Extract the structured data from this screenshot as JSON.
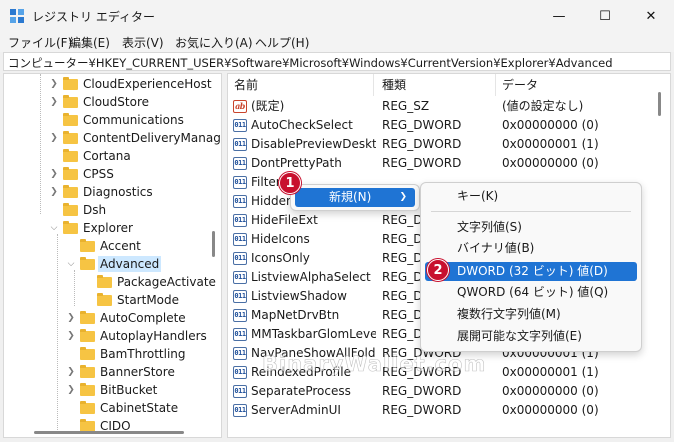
{
  "window": {
    "title": "レジストリ エディター",
    "minimize_glyph": "—",
    "maximize_glyph": "☐",
    "close_glyph": "✕"
  },
  "menubar": [
    {
      "label": "ファイル(F)"
    },
    {
      "label": "編集(E)"
    },
    {
      "label": "表示(V)"
    },
    {
      "label": "お気に入り(A)"
    },
    {
      "label": "ヘルプ(H)"
    }
  ],
  "address": "コンピューター¥HKEY_CURRENT_USER¥Software¥Microsoft¥Windows¥CurrentVersion¥Explorer¥Advanced",
  "tree": {
    "items": [
      {
        "label": "CloudExperienceHost"
      },
      {
        "label": "CloudStore"
      },
      {
        "label": "Communications"
      },
      {
        "label": "ContentDeliveryManag"
      },
      {
        "label": "Cortana"
      },
      {
        "label": "CPSS"
      },
      {
        "label": "Diagnostics"
      },
      {
        "label": "Dsh"
      },
      {
        "label": "Explorer"
      },
      {
        "label": "Accent"
      },
      {
        "label": "Advanced"
      },
      {
        "label": "PackageActivate"
      },
      {
        "label": "StartMode"
      },
      {
        "label": "AutoComplete"
      },
      {
        "label": "AutoplayHandlers"
      },
      {
        "label": "BamThrottling"
      },
      {
        "label": "BannerStore"
      },
      {
        "label": "BitBucket"
      },
      {
        "label": "CabinetState"
      },
      {
        "label": "CIDO"
      }
    ]
  },
  "list": {
    "columns": [
      "名前",
      "種類",
      "データ"
    ],
    "rows": [
      {
        "name": "(既定)",
        "type": "REG_SZ",
        "data": "(値の設定なし)",
        "icon": "string-value-icon"
      },
      {
        "name": "AutoCheckSelect",
        "type": "REG_DWORD",
        "data": "0x00000000 (0)",
        "icon": "dword-value-icon"
      },
      {
        "name": "DisablePreviewDesktop",
        "type": "REG_DWORD",
        "data": "0x00000001 (1)",
        "icon": "dword-value-icon"
      },
      {
        "name": "DontPrettyPath",
        "type": "REG_DWORD",
        "data": "0x00000000 (0)",
        "icon": "dword-value-icon"
      },
      {
        "name": "Filter",
        "type": "",
        "data": "",
        "icon": "dword-value-icon"
      },
      {
        "name": "Hidden",
        "type": "",
        "data": "",
        "icon": "dword-value-icon"
      },
      {
        "name": "HideFileExt",
        "type": "REG_DWO",
        "data": "",
        "icon": "dword-value-icon"
      },
      {
        "name": "HideIcons",
        "type": "REG_DWO",
        "data": "",
        "icon": "dword-value-icon"
      },
      {
        "name": "IconsOnly",
        "type": "REG_DWO",
        "data": "",
        "icon": "dword-value-icon"
      },
      {
        "name": "ListviewAlphaSelect",
        "type": "REG_DWO",
        "data": "",
        "icon": "dword-value-icon"
      },
      {
        "name": "ListviewShadow",
        "type": "REG_DWO",
        "data": "",
        "icon": "dword-value-icon"
      },
      {
        "name": "MapNetDrvBtn",
        "type": "REG_DWO",
        "data": "",
        "icon": "dword-value-icon"
      },
      {
        "name": "MMTaskbarGlomLevel",
        "type": "REG_DWO",
        "data": "",
        "icon": "dword-value-icon"
      },
      {
        "name": "NavPaneShowAllFold...",
        "type": "REG_DWORD",
        "data": "0x00000001 (1)",
        "icon": "dword-value-icon"
      },
      {
        "name": "ReindexedProfile",
        "type": "REG_DWORD",
        "data": "0x00000001 (1)",
        "icon": "dword-value-icon"
      },
      {
        "name": "SeparateProcess",
        "type": "REG_DWORD",
        "data": "0x00000000 (0)",
        "icon": "dword-value-icon"
      },
      {
        "name": "ServerAdminUI",
        "type": "REG_DWORD",
        "data": "0x00000000 (0)",
        "icon": "dword-value-icon"
      }
    ]
  },
  "context_menu": {
    "new_label": "新規(N)"
  },
  "submenu": {
    "items": [
      {
        "label": "キー(K)"
      },
      {
        "label": "文字列値(S)"
      },
      {
        "label": "バイナリ値(B)"
      },
      {
        "label": "DWORD (32 ビット) 値(D)"
      },
      {
        "label": "QWORD (64 ビット) 値(Q)"
      },
      {
        "label": "複数行文字列値(M)"
      },
      {
        "label": "展開可能な文字列値(E)"
      }
    ]
  },
  "badges": {
    "one": "1",
    "two": "2"
  },
  "watermark": "BinaryWallet.com",
  "colors": {
    "highlight": "#1f74d4",
    "selection": "#cde8ff",
    "badge": "#c8102e",
    "folder": "#f6c443"
  }
}
